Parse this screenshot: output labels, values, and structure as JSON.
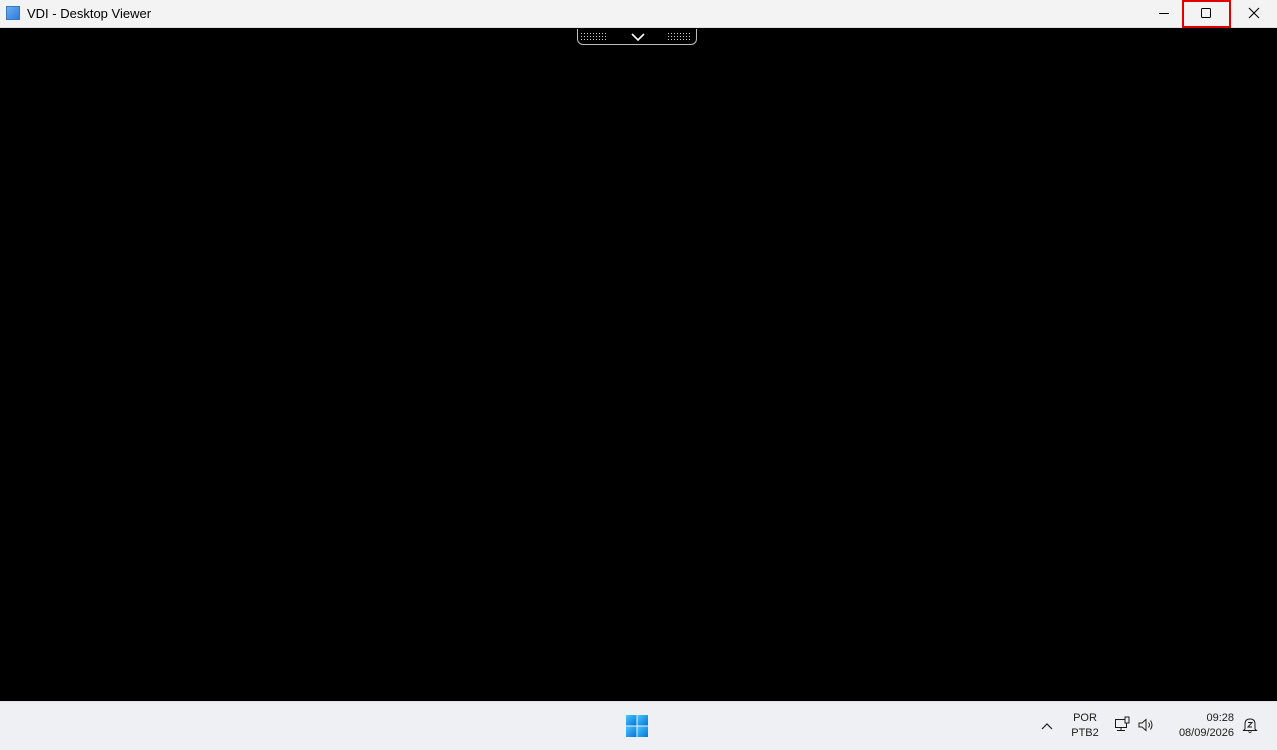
{
  "window": {
    "title": "VDI - Desktop Viewer",
    "buttons": {
      "minimize": "minimize-icon",
      "maximize": "maximize-icon",
      "close": "close-icon"
    }
  },
  "toolbar": {
    "toggle_icon": "chevron-down-icon"
  },
  "taskbar": {
    "language": {
      "code": "POR",
      "layout": "PTB2"
    },
    "clock": {
      "time": "09:28",
      "date": "08/09/2026"
    },
    "icons": [
      "windows-start-icon",
      "show-hidden-icons-chevron",
      "network-icon",
      "volume-icon",
      "notifications-bell-icon"
    ]
  },
  "colors": {
    "highlight": "#e00000",
    "accent": "#0078d4",
    "background": "#000000"
  }
}
